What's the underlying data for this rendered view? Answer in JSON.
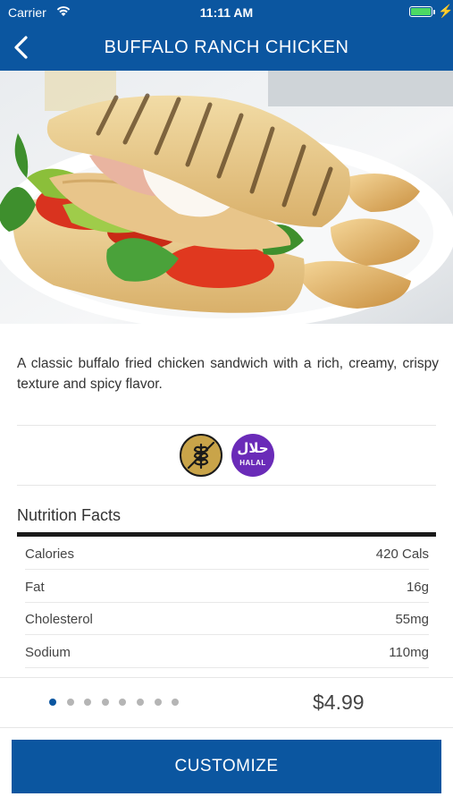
{
  "status_bar": {
    "carrier": "Carrier",
    "time": "11:11 AM",
    "battery_color": "#4cd964"
  },
  "nav": {
    "title": "BUFFALO RANCH CHICKEN",
    "back_icon": "chevron-left-icon",
    "background": "#0b56a0"
  },
  "item": {
    "description": "A classic buffalo fried chicken sandwich with a rich, creamy, crispy texture and spicy flavor.",
    "badges": [
      {
        "icon": "gluten-free-icon",
        "color": "#c9a449"
      },
      {
        "icon": "halal-icon",
        "color": "#6a2bb8",
        "text": "HALAL",
        "arabic": "حلال"
      }
    ]
  },
  "nutrition": {
    "title": "Nutrition Facts",
    "rows": [
      {
        "label": "Calories",
        "value": "420 Cals"
      },
      {
        "label": "Fat",
        "value": "16g"
      },
      {
        "label": "Cholesterol",
        "value": "55mg"
      },
      {
        "label": "Sodium",
        "value": "110mg"
      }
    ]
  },
  "pager": {
    "count": 8,
    "active_index": 0
  },
  "price": "$4.99",
  "cta": {
    "label": "CUSTOMIZE"
  }
}
